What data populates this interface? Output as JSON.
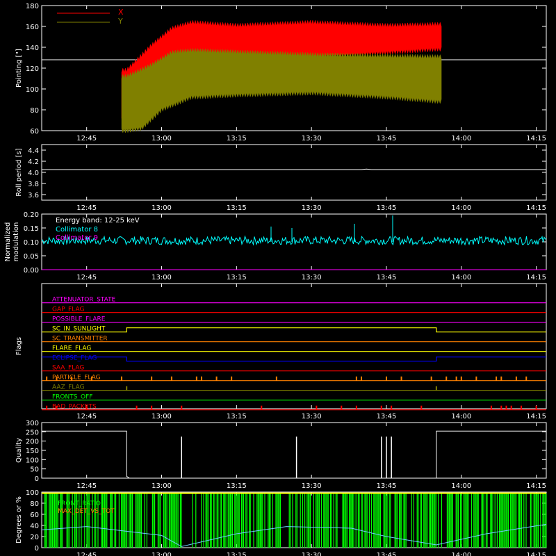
{
  "time_ticks": [
    "12:45",
    "13:00",
    "13:15",
    "13:30",
    "13:45",
    "14:00",
    "14:15"
  ],
  "colors": {
    "x": "#ff0000",
    "y": "#808000",
    "white": "#ffffff",
    "cyan": "#00ffff",
    "magenta": "#ff00ff",
    "green": "#00ff00",
    "yellow": "#ffff00",
    "orange": "#ff8000",
    "blue": "#0000ff",
    "red": "#ff0000",
    "lightblue": "#6bd0ff"
  },
  "chart_data": [
    {
      "type": "line",
      "id": "pointing",
      "ylabel": "Pointing [\"]",
      "ylim": [
        60,
        180
      ],
      "yticks": [
        60,
        80,
        100,
        120,
        140,
        160,
        180
      ],
      "xlim": [
        "12:36",
        "14:17"
      ],
      "reference_line": 128,
      "data_span": [
        "12:52",
        "13:56"
      ],
      "series": [
        {
          "name": "X",
          "color": "#ff0000",
          "envelope_top": [
            [
              "12:53",
              118
            ],
            [
              "12:58",
              142
            ],
            [
              "13:02",
              158
            ],
            [
              "13:06",
              164
            ],
            [
              "13:15",
              161
            ],
            [
              "13:30",
              164
            ],
            [
              "13:45",
              161
            ],
            [
              "13:55",
              162
            ]
          ],
          "envelope_bottom": [
            [
              "12:53",
              70
            ],
            [
              "12:58",
              90
            ],
            [
              "13:02",
              118
            ],
            [
              "13:10",
              125
            ],
            [
              "13:30",
              130
            ],
            [
              "13:55",
              138
            ]
          ]
        },
        {
          "name": "Y",
          "color": "#808000",
          "envelope_top": [
            [
              "12:53",
              112
            ],
            [
              "12:58",
              123
            ],
            [
              "13:02",
              135
            ],
            [
              "13:06",
              137
            ],
            [
              "13:30",
              133
            ],
            [
              "13:55",
              131
            ]
          ],
          "envelope_bottom": [
            [
              "12:53",
              60
            ],
            [
              "12:56",
              62
            ],
            [
              "13:00",
              80
            ],
            [
              "13:06",
              92
            ],
            [
              "13:15",
              94
            ],
            [
              "13:30",
              96
            ],
            [
              "13:45",
              92
            ],
            [
              "13:55",
              88
            ]
          ]
        }
      ]
    },
    {
      "type": "line",
      "id": "roll_period",
      "ylabel": "Roll period [s]",
      "ylim": [
        3.5,
        4.5
      ],
      "yticks": [
        3.6,
        3.8,
        4.0,
        4.2,
        4.4
      ],
      "series": [
        {
          "name": "",
          "color": "#ffffff",
          "values": [
            [
              "12:36",
              4.05
            ],
            [
              "13:40",
              4.05
            ],
            [
              "13:41",
              4.06
            ],
            [
              "13:42",
              4.05
            ],
            [
              "14:17",
              4.05
            ]
          ]
        }
      ]
    },
    {
      "type": "line",
      "id": "modulation",
      "ylabel": "Normalized modulation",
      "ylim": [
        0,
        0.2
      ],
      "yticks": [
        0.0,
        0.05,
        0.1,
        0.15,
        0.2
      ],
      "annotations": [
        "Energy band: 12-25 keV"
      ],
      "series": [
        {
          "name": "Collimator 8",
          "color": "#00ffff",
          "mean": 0.105,
          "noise": 0.015
        },
        {
          "name": "Collimator 9",
          "color": "#ff00ff",
          "values": [
            [
              "12:36",
              0.0
            ],
            [
              "14:17",
              0.0
            ]
          ]
        }
      ]
    },
    {
      "type": "line",
      "id": "flags",
      "ylabel": "Flags",
      "series": [
        {
          "name": "ATTENUATOR_STATE",
          "color": "#ff00ff",
          "level": 0,
          "segments": []
        },
        {
          "name": "GAP_FLAG",
          "color": "#ff0000",
          "level": 0,
          "segments": []
        },
        {
          "name": "POSSIBLE_FLARE",
          "color": "#ff00ff",
          "level": 0,
          "segments": []
        },
        {
          "name": "SC_IN_SUNLIGHT",
          "color": "#ffff00",
          "level": 0,
          "segments": [
            [
              "12:53",
              "13:55"
            ]
          ]
        },
        {
          "name": "SC_TRANSMITTER",
          "color": "#ff8000",
          "level": 0,
          "segments": []
        },
        {
          "name": "FLARE_FLAG",
          "color": "#ffff00",
          "level": 0,
          "segments": []
        },
        {
          "name": "ECLIPSE_FLAG",
          "color": "#0000ff",
          "level": 1,
          "segments": [
            [
              "12:53",
              "13:55"
            ]
          ]
        },
        {
          "name": "SAA_FLAG",
          "color": "#ff0000",
          "level": 0,
          "segments": []
        },
        {
          "name": "PARTICLE_FLAG",
          "color": "#ff8000",
          "level": 0,
          "pulses": [
            "12:37",
            "12:39",
            "12:42",
            "12:46",
            "12:52",
            "12:58",
            "13:02",
            "13:07",
            "13:08",
            "13:11",
            "13:14",
            "13:23",
            "13:39",
            "13:40",
            "13:45",
            "13:48",
            "13:54",
            "13:57",
            "13:59",
            "14:00",
            "14:03",
            "14:07",
            "14:08",
            "14:11",
            "14:13"
          ]
        },
        {
          "name": "AAZ_FLAG",
          "color": "#808000",
          "level": 0,
          "pulses": [
            "12:53",
            "13:55"
          ]
        },
        {
          "name": "FRONTS_OFF",
          "color": "#00ff00",
          "level": 0,
          "segments": []
        },
        {
          "name": "BAD_PACKETS",
          "color": "#ff0000",
          "level": 0,
          "pulses": [
            "12:37",
            "12:39",
            "12:45",
            "12:55",
            "12:58",
            "13:04",
            "13:20",
            "13:31",
            "13:36",
            "13:39",
            "13:44",
            "13:46",
            "13:52",
            "14:06",
            "14:08",
            "14:09",
            "14:10",
            "14:12",
            "14:15"
          ]
        }
      ]
    },
    {
      "type": "line",
      "id": "quality",
      "ylabel": "Quality",
      "ylim": [
        0,
        300
      ],
      "yticks": [
        0,
        50,
        100,
        150,
        200,
        250,
        300
      ],
      "series": [
        {
          "name": "",
          "color": "#ffffff",
          "baseline": 254,
          "gap": [
            "12:53",
            "13:55"
          ],
          "spikes": [
            "13:04",
            "13:27",
            "13:44",
            "13:45",
            "13:46"
          ]
        }
      ]
    },
    {
      "type": "line",
      "id": "degrees",
      "ylabel": "Degrees or %",
      "ylim": [
        0,
        100
      ],
      "yticks": [
        0,
        20,
        40,
        60,
        80,
        100
      ],
      "annotations": [
        "FRONT_RATIO",
        "MAX_DET_VS_TOT"
      ],
      "series": [
        {
          "name": "FRONT_RATIO",
          "color": "#00ff00"
        },
        {
          "name": "MAX_DET_VS_TOT",
          "color": "#ff8000"
        },
        {
          "name": "",
          "color": "#ffff00",
          "level": 98
        },
        {
          "name": "",
          "color": "#6bd0ff",
          "values": [
            [
              "12:36",
              32
            ],
            [
              "12:45",
              38
            ],
            [
              "13:00",
              22
            ],
            [
              "13:04",
              2
            ],
            [
              "13:15",
              25
            ],
            [
              "13:25",
              38
            ],
            [
              "13:38",
              35
            ],
            [
              "13:45",
              20
            ],
            [
              "13:55",
              5
            ],
            [
              "14:05",
              25
            ],
            [
              "14:17",
              42
            ]
          ]
        }
      ]
    }
  ]
}
